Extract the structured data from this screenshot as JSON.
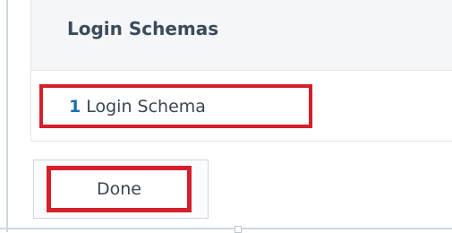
{
  "panel": {
    "title": "Login Schemas",
    "schema_link": {
      "count": "1",
      "label": "Login Schema"
    }
  },
  "actions": {
    "done_label": "Done"
  },
  "colors": {
    "highlight": "#d61f2b",
    "link": "#1a6fb0",
    "header_bg": "#f4f6f8"
  }
}
